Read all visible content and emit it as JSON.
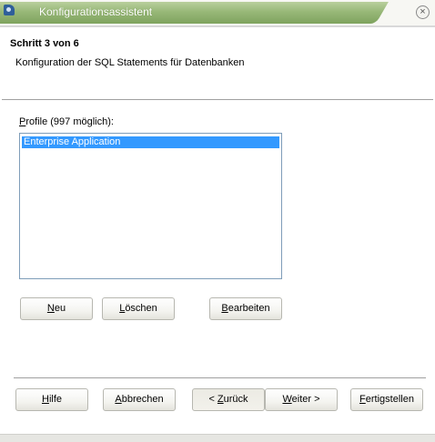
{
  "window": {
    "title": "Konfigurationsassistent",
    "close_symbol": "×"
  },
  "header": {
    "step": "Schritt 3 von 6",
    "description": "Konfiguration der SQL Statements für Datenbanken"
  },
  "profiles": {
    "label_mnemonic": "P",
    "label_rest": "rofile (997 möglich):",
    "items": [
      "Enterprise Application"
    ],
    "selected_index": 0
  },
  "profile_buttons": {
    "new": {
      "mnemonic": "N",
      "rest": "eu"
    },
    "delete": {
      "mnemonic": "L",
      "rest": "öschen"
    },
    "edit": {
      "mnemonic": "B",
      "rest": "earbeiten"
    }
  },
  "nav_buttons": {
    "help": {
      "mnemonic": "H",
      "rest": "ilfe"
    },
    "cancel": {
      "mnemonic": "A",
      "rest": "bbrechen"
    },
    "back": {
      "prefix": "< ",
      "mnemonic": "Z",
      "rest": "urück"
    },
    "next": {
      "mnemonic": "W",
      "rest": "eiter >"
    },
    "finish": {
      "mnemonic": "F",
      "rest": "ertigstellen"
    }
  },
  "colors": {
    "title_bar": "#98b878",
    "selection": "#3399ff",
    "list_border": "#7f9db9"
  }
}
